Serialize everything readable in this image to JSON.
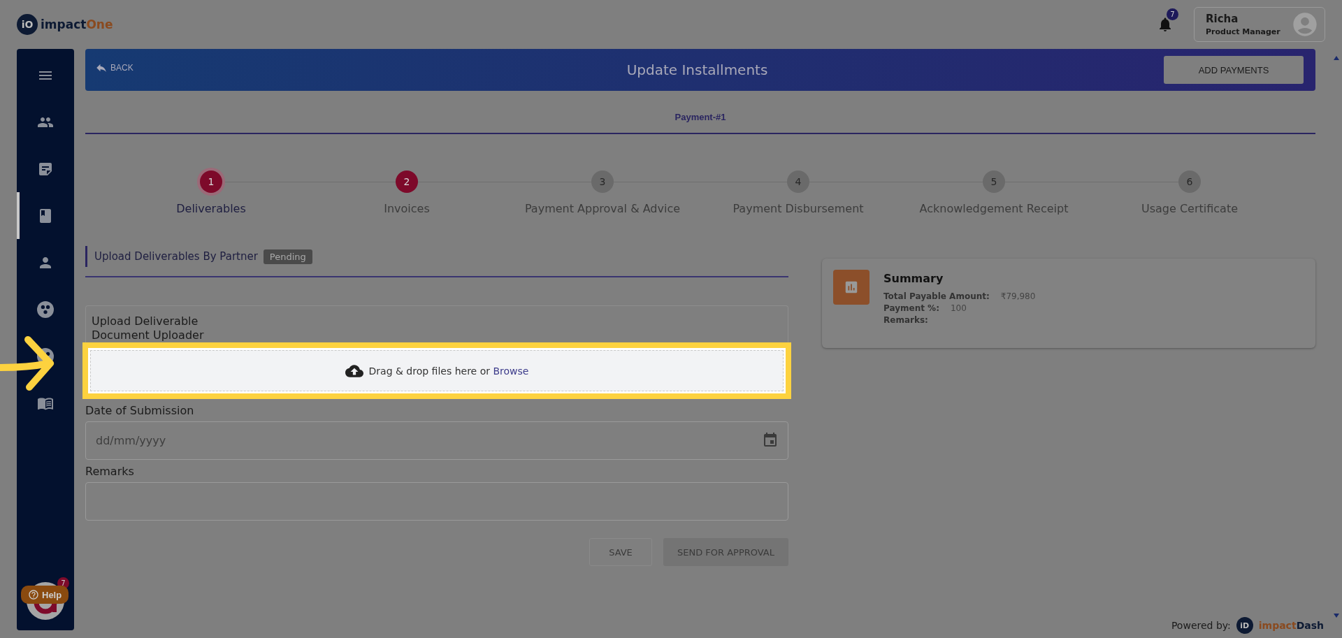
{
  "brand": {
    "logo_mark": "iO",
    "name_a": "impact",
    "name_b": "One"
  },
  "notifications": {
    "count": "7"
  },
  "user": {
    "name": "Richa",
    "role": "Product Manager"
  },
  "sidebar": {
    "items": [
      {
        "selected": false
      },
      {
        "selected": false
      },
      {
        "selected": false
      },
      {
        "selected": true
      },
      {
        "selected": false
      },
      {
        "selected": false
      },
      {
        "selected": false
      },
      {
        "selected": false
      }
    ],
    "badge": "7",
    "help": "Help"
  },
  "header": {
    "back": "BACK",
    "title": "Update Installments",
    "action": "ADD PAYMENTS"
  },
  "payment_tab": "Payment-#1",
  "steps": [
    {
      "number": "1",
      "label": "Deliverables",
      "selected": true,
      "done": true
    },
    {
      "number": "2",
      "label": "Invoices",
      "selected": false,
      "done": true
    },
    {
      "number": "3",
      "label": "Payment Approval & Advice",
      "selected": false,
      "done": false
    },
    {
      "number": "4",
      "label": "Payment Disbursement",
      "selected": false,
      "done": false
    },
    {
      "number": "5",
      "label": "Acknowledgement Receipt",
      "selected": false,
      "done": false
    },
    {
      "number": "6",
      "label": "Usage Certificate",
      "selected": false,
      "done": false
    }
  ],
  "section": {
    "title": "Upload Deliverables By Partner",
    "status_badge": "Pending"
  },
  "uploader": {
    "title": "Upload Deliverable",
    "subtitle": "Document Uploader",
    "drop_text": "Drag & drop files here or ",
    "browse": "Browse",
    "highlighted": true
  },
  "date_field": {
    "label": "Date of Submission",
    "placeholder": "dd/mm/yyyy"
  },
  "remarks_field": {
    "label": "Remarks"
  },
  "buttons": [
    {
      "label": "SAVE",
      "kind": "outline",
      "disabled": true
    },
    {
      "label": "SEND FOR APPROVAL",
      "kind": "filled",
      "disabled": true
    }
  ],
  "summary": {
    "title": "Summary",
    "rows": [
      {
        "label": "Total Payable Amount:",
        "value": "₹79,980"
      },
      {
        "label": "Payment %:",
        "value": "100"
      },
      {
        "label": "Remarks:"
      }
    ]
  },
  "footer": {
    "powered_by": "Powered by:",
    "logo_mark": "iD",
    "name_a": "impact",
    "name_b": "Dash"
  }
}
